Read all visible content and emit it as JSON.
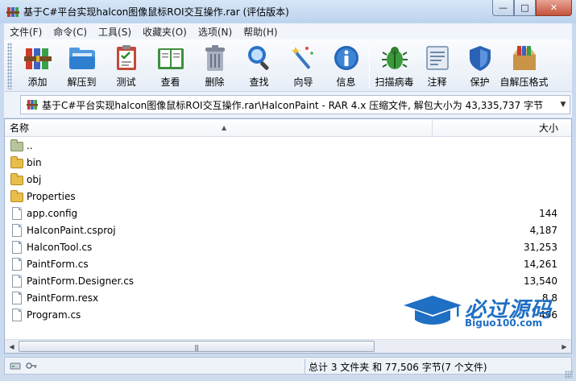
{
  "window": {
    "title": "基于C#平台实现halcon图像鼠标ROI交互操作.rar (评估版本)",
    "controls": [
      "minimize-button",
      "maximize-button",
      "close-button"
    ],
    "minimize_glyph": "—",
    "maximize_glyph": "□",
    "close_glyph": "✕"
  },
  "menu": [
    "文件(F)",
    "命令(C)",
    "工具(S)",
    "收藏夹(O)",
    "选项(N)",
    "帮助(H)"
  ],
  "toolbar": [
    {
      "label": "添加",
      "icon": "add-books-icon",
      "color": "#cc3b2c"
    },
    {
      "label": "解压到",
      "icon": "extract-folder-icon",
      "color": "#3c8ad6"
    },
    {
      "label": "测试",
      "icon": "test-clipboard-icon",
      "color": "#c24a3a"
    },
    {
      "label": "查看",
      "icon": "view-book-icon",
      "color": "#3f8f3f"
    },
    {
      "label": "删除",
      "icon": "delete-trash-icon",
      "color": "#8a93a3"
    },
    {
      "label": "查找",
      "icon": "find-magnifier-icon",
      "color": "#2b72c8"
    },
    {
      "label": "向导",
      "icon": "wizard-wand-icon",
      "color": "#3a78c0"
    },
    {
      "label": "信息",
      "icon": "info-icon",
      "color": "#2566b8"
    },
    {
      "label": "扫描病毒",
      "icon": "virus-scan-icon",
      "color": "#3b9a3b"
    },
    {
      "label": "注释",
      "icon": "comment-icon",
      "color": "#6e87a8"
    },
    {
      "label": "保护",
      "icon": "protect-shield-icon",
      "color": "#2a63b5"
    },
    {
      "label": "自解压格式",
      "icon": "sfx-box-icon",
      "color": "#b9843a"
    }
  ],
  "path": {
    "text": "基于C#平台实现halcon图像鼠标ROI交互操作.rar\\HalconPaint - RAR 4.x 压缩文件, 解包大小为 43,335,737 字节",
    "dropdown_glyph": "▼"
  },
  "list": {
    "columns": {
      "name": "名称",
      "size": "大小",
      "sort_glyph": "▲"
    },
    "rows": [
      {
        "name": "..",
        "size": "",
        "type": "up"
      },
      {
        "name": "bin",
        "size": "",
        "type": "folder"
      },
      {
        "name": "obj",
        "size": "",
        "type": "folder"
      },
      {
        "name": "Properties",
        "size": "",
        "type": "folder"
      },
      {
        "name": "app.config",
        "size": "144",
        "type": "file"
      },
      {
        "name": "HalconPaint.csproj",
        "size": "4,187",
        "type": "file"
      },
      {
        "name": "HalconTool.cs",
        "size": "31,253",
        "type": "file"
      },
      {
        "name": "PaintForm.cs",
        "size": "14,261",
        "type": "file"
      },
      {
        "name": "PaintForm.Designer.cs",
        "size": "13,540",
        "type": "file"
      },
      {
        "name": "PaintForm.resx",
        "size": "8,8",
        "type": "file"
      },
      {
        "name": "Program.cs",
        "size": "496",
        "type": "file"
      }
    ]
  },
  "scrollbar": {
    "left_glyph": "◀",
    "right_glyph": "▶",
    "grip_glyph": "|||"
  },
  "watermark": {
    "text": "必过源码",
    "url": "Biguo100.com"
  },
  "status": {
    "text": "总计 3 文件夹 和 77,506 字节(7 个文件)"
  },
  "colors": {
    "accent": "#1f6fc4",
    "titlebar": "#c9daf0"
  }
}
